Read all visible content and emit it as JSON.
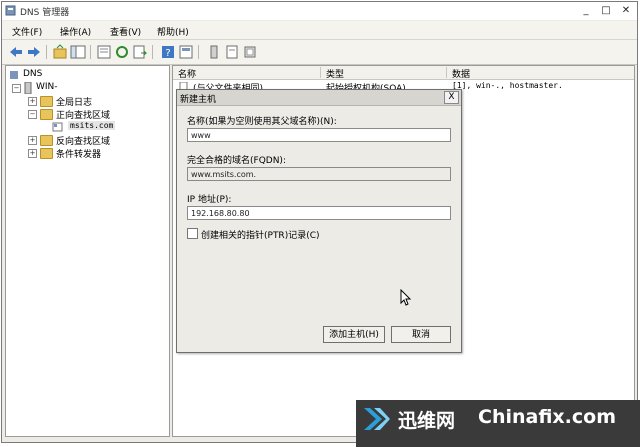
{
  "window": {
    "title": "DNS 管理器",
    "controls": {
      "minimize": "_",
      "maximize": "□",
      "close": "✕"
    }
  },
  "menu": [
    "文件(F)",
    "操作(A)",
    "查看(V)",
    "帮助(H)"
  ],
  "tree": {
    "root": "DNS",
    "server": "WIN-",
    "items": [
      "全局日志",
      "正向查找区域",
      "msits.com",
      "反向查找区域",
      "条件转发器"
    ]
  },
  "list": {
    "columns": [
      "名称",
      "类型",
      "数据"
    ],
    "rows": [
      {
        "name": "(与父文件夹相同)",
        "type": "起始授权机构(SOA)",
        "data": "[1], win-., hostmaster."
      }
    ]
  },
  "dialog": {
    "title": "新建主机",
    "close": "X",
    "name_label": "名称(如果为空则使用其父域名称)(N):",
    "name_value": "www",
    "fqdn_label": "完全合格的域名(FQDN):",
    "fqdn_value": "www.msits.com.",
    "ip_label": "IP 地址(P):",
    "ip_value": "192.168.80.80",
    "ptr_label": "创建相关的指针(PTR)记录(C)",
    "add_button": "添加主机(H)",
    "cancel_button": "取消"
  },
  "watermark": {
    "brand_cn": "迅维网",
    "brand_en": "Chinafix.com"
  },
  "colors": {
    "folder": "#e8c45a",
    "watermark_bg": "#3a3a3a"
  }
}
